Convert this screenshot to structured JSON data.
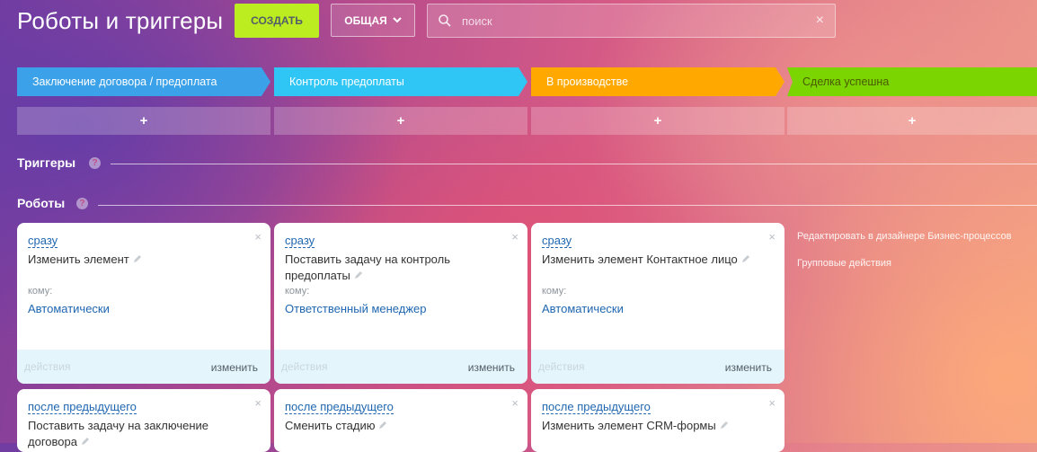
{
  "header": {
    "title": "Роботы и триггеры",
    "create_label": "СОЗДАТЬ",
    "general_label": "ОБЩАЯ",
    "search_placeholder": "поиск"
  },
  "stages": [
    {
      "label": "Заключение договора / предоплата",
      "color": "#3ba1e8"
    },
    {
      "label": "Контроль предоплаты",
      "color": "#2fc6f6"
    },
    {
      "label": "В производстве",
      "color": "#ffa900"
    },
    {
      "label": "Сделка успешна",
      "color": "#7bd500"
    }
  ],
  "add_symbol": "+",
  "sections": {
    "triggers": "Триггеры",
    "robots": "Роботы",
    "help": "?"
  },
  "robots_row1": [
    {
      "when": "сразу",
      "action": "Изменить элемент",
      "to_label": "кому:",
      "to_value": "Автоматически",
      "actions": "действия",
      "edit": "изменить"
    },
    {
      "when": "сразу",
      "action": "Поставить задачу на контроль предоплаты",
      "to_label": "кому:",
      "to_value": "Ответственный менеджер",
      "actions": "действия",
      "edit": "изменить"
    },
    {
      "when": "сразу",
      "action": "Изменить элемент Контактное лицо",
      "to_label": "кому:",
      "to_value": "Автоматически",
      "actions": "действия",
      "edit": "изменить"
    }
  ],
  "robots_row2": [
    {
      "when": "после предыдущего",
      "action": "Поставить задачу на заключение договора"
    },
    {
      "when": "после предыдущего",
      "action": "Сменить стадию"
    },
    {
      "when": "после предыдущего",
      "action": "Изменить элемент CRM-формы"
    }
  ],
  "side_links": {
    "designer": "Редактировать в дизайнере Бизнес-процессов",
    "group": "Групповые действия"
  },
  "close_symbol": "×"
}
